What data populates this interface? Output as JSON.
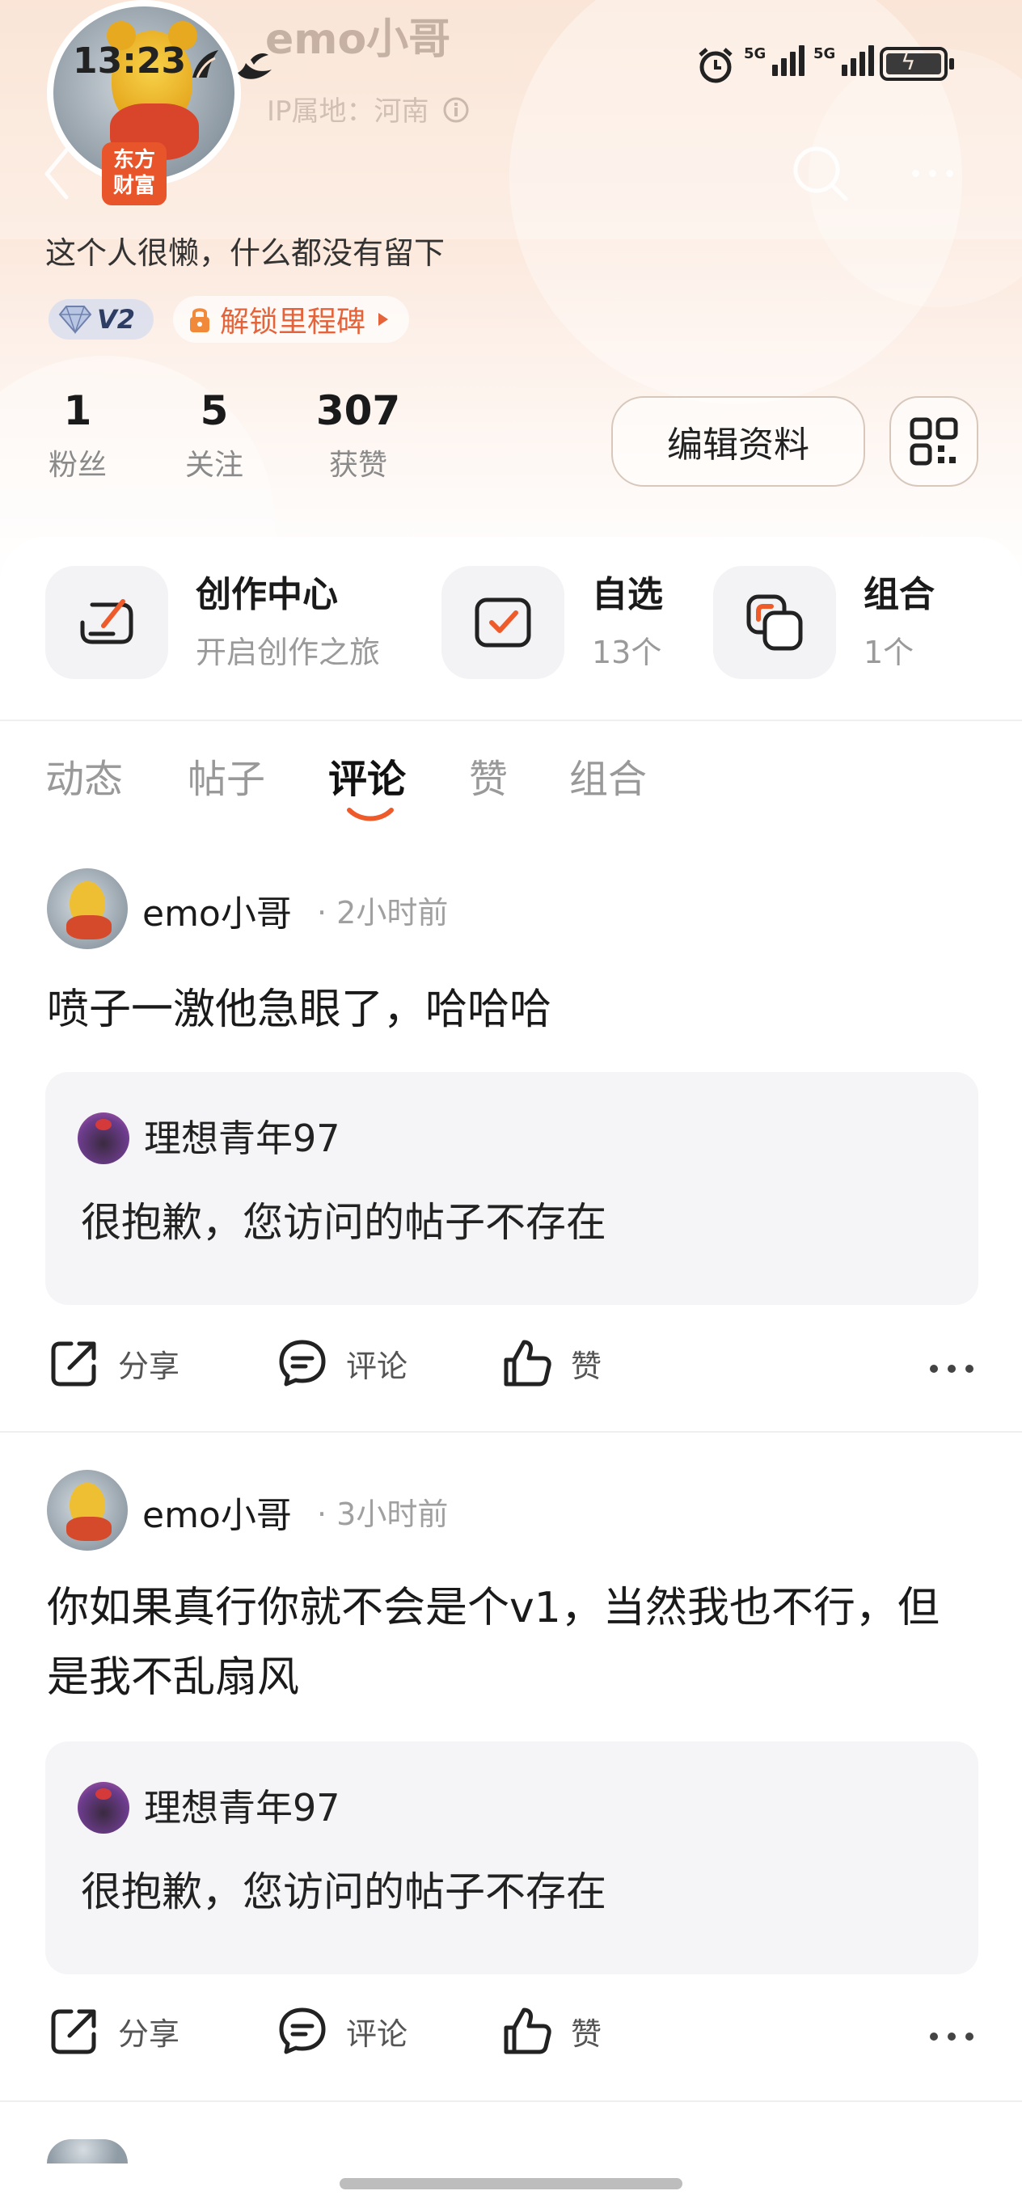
{
  "status_bar": {
    "time": "13:23",
    "net1": "5G",
    "net2": "5G"
  },
  "profile": {
    "username": "emo小哥",
    "ip_location": "IP属地：河南",
    "brand_badge": "东方财富",
    "bio": "这个人很懒，什么都没有留下",
    "level": "V2",
    "milestone": "解锁里程碑",
    "stats": [
      {
        "value": "1",
        "label": "粉丝"
      },
      {
        "value": "5",
        "label": "关注"
      },
      {
        "value": "307",
        "label": "获赞"
      }
    ],
    "edit_label": "编辑资料"
  },
  "quick_links": [
    {
      "title": "创作中心",
      "subtitle": "开启创作之旅"
    },
    {
      "title": "自选",
      "subtitle": "13个"
    },
    {
      "title": "组合",
      "subtitle": "1个"
    }
  ],
  "tabs": [
    "动态",
    "帖子",
    "评论",
    "赞",
    "组合"
  ],
  "active_tab": "评论",
  "comments": [
    {
      "author": "emo小哥",
      "time": "· 2小时前",
      "text": "喷子一激他急眼了，哈哈哈",
      "quote_author": "理想青年97",
      "quote_text": "很抱歉，您访问的帖子不存在"
    },
    {
      "author": "emo小哥",
      "time": "· 3小时前",
      "text": "你如果真行你就不会是个v1，当然我也不行，但是我不乱扇风",
      "quote_author": "理想青年97",
      "quote_text": "很抱歉，您访问的帖子不存在"
    }
  ],
  "actions": {
    "share": "分享",
    "comment": "评论",
    "like": "赞"
  },
  "colors": {
    "accent": "#e8552a",
    "header_bg": "#f9dcc8",
    "text_muted": "#999999"
  }
}
